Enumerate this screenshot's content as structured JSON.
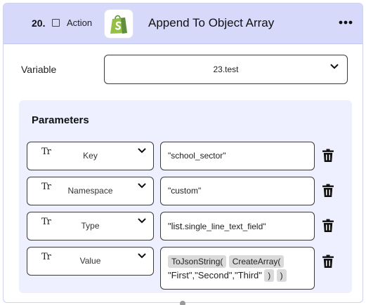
{
  "step": {
    "number": "20.",
    "kind": "Action",
    "title": "Append To Object Array",
    "app_icon": "shopify-bag-icon",
    "brand_color": "#95bf47"
  },
  "variable": {
    "label": "Variable",
    "value": "23.test"
  },
  "parameters": {
    "title": "Parameters",
    "type_icon_text": "Tr",
    "rows": [
      {
        "key": "Key",
        "value": "\"school_sector\""
      },
      {
        "key": "Namespace",
        "value": "\"custom\""
      },
      {
        "key": "Type",
        "value_bold": "\"list",
        "value_rest": ".single_line_text_field\""
      },
      {
        "key": "Value",
        "chips": [
          "ToJsonString(",
          "CreateArray(",
          ")",
          ")"
        ],
        "args": "\"First\",\"Second\",\"Third\""
      }
    ]
  },
  "colors": {
    "header_bg": "#d6d9f9",
    "params_bg": "#eef0ff",
    "chip_bg": "#dadada"
  }
}
